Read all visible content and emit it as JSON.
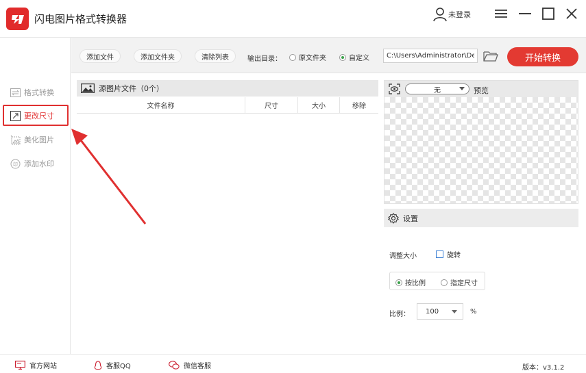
{
  "app": {
    "title": "闪电图片格式转换器"
  },
  "user": {
    "label": "未登录"
  },
  "sidebar": {
    "items": [
      {
        "label": "格式转换",
        "icon": "swap-icon"
      },
      {
        "label": "更改尺寸",
        "icon": "resize-icon",
        "active": true
      },
      {
        "label": "美化图片",
        "icon": "beautify-icon"
      },
      {
        "label": "添加水印",
        "icon": "watermark-icon"
      }
    ]
  },
  "toolbar": {
    "add_file": "添加文件",
    "add_folder": "添加文件夹",
    "clear_list": "清除列表",
    "output_label": "输出目录：",
    "radio_original": "原文件夹",
    "radio_custom": "自定义",
    "output_path": "C:\\Users\\Administrator\\De",
    "start": "开始转换"
  },
  "file_panel": {
    "title": "源图片文件（0个）",
    "columns": [
      "文件名称",
      "尺寸",
      "大小",
      "移除"
    ]
  },
  "preview": {
    "select_value": "无",
    "label": "预览"
  },
  "settings": {
    "title": "设置",
    "resize_label": "调整大小",
    "rotate_label": "旋转",
    "by_ratio": "按比例",
    "by_size": "指定尺寸",
    "ratio_label": "比例：",
    "ratio_value": "100",
    "percent": "%"
  },
  "footer": {
    "website": "官方网站",
    "qq": "客服QQ",
    "wechat": "微信客服",
    "version": "版本：v3.1.2"
  },
  "colors": {
    "accent": "#e33a32",
    "annotation": "#e03030",
    "selected_radio": "#3aa04a"
  }
}
